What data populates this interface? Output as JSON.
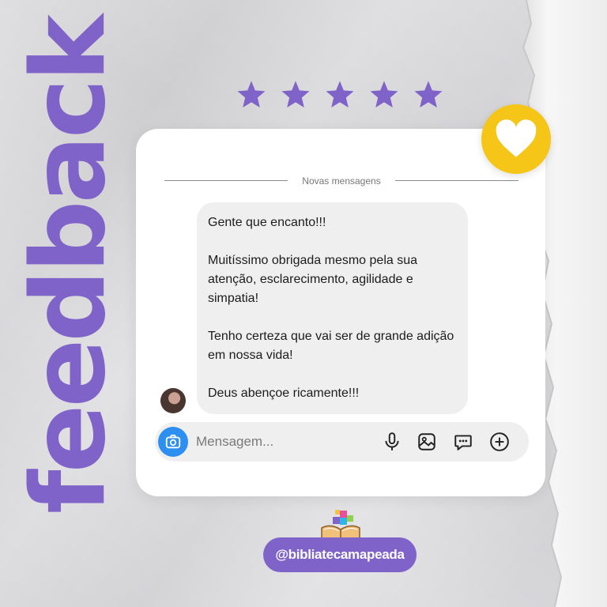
{
  "vertical_word": "feedback",
  "rating": {
    "stars": 5,
    "max": 5,
    "color": "#7f63c9"
  },
  "chat": {
    "divider_label": "Novas mensagens",
    "message_paragraphs": [
      "Gente que encanto!!!",
      "Muitíssimo obrigada mesmo pela sua atenção, esclarecimento, agilidade e simpatia!",
      "Tenho certeza que vai ser de grande adição em nossa vida!",
      "Deus abençoe ricamente!!!"
    ],
    "composer_placeholder": "Mensagem..."
  },
  "icons": {
    "badge": "heart-icon",
    "camera": "camera-icon",
    "mic": "microphone-icon",
    "gallery": "image-icon",
    "sticker": "chat-bubble-icon",
    "add": "plus-circle-icon",
    "logo": "book-puzzle-icon"
  },
  "handle": "@bibliatecamapeada",
  "colors": {
    "accent": "#7f63c9",
    "badge": "#f5c518",
    "camera": "#2d8ff0",
    "background": "#d9d9dc"
  }
}
